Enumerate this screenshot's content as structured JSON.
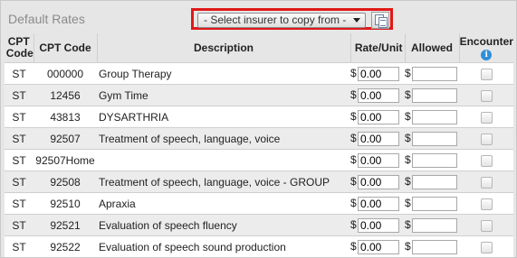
{
  "panel_title": "Default Rates",
  "copy_from": {
    "selected": "- Select insurer to copy from -",
    "icon": "copy-document-icon"
  },
  "columns": {
    "cpt_code_type": "CPT Code",
    "cpt_code": "CPT Code",
    "description": "Description",
    "rate_unit": "Rate/Unit",
    "allowed": "Allowed",
    "encounter": "Encounter"
  },
  "currency_symbol": "$",
  "rows": [
    {
      "type": "ST",
      "code": "000000",
      "description": "Group Therapy",
      "rate": "0.00",
      "allowed": "",
      "encounter": false
    },
    {
      "type": "ST",
      "code": "12456",
      "description": "Gym Time",
      "rate": "0.00",
      "allowed": "",
      "encounter": false
    },
    {
      "type": "ST",
      "code": "43813",
      "description": "DYSARTHRIA",
      "rate": "0.00",
      "allowed": "",
      "encounter": false
    },
    {
      "type": "ST",
      "code": "92507",
      "description": "Treatment of speech, language, voice",
      "rate": "0.00",
      "allowed": "",
      "encounter": false
    },
    {
      "type": "ST",
      "code": "92507Home",
      "description": "",
      "rate": "0.00",
      "allowed": "",
      "encounter": false
    },
    {
      "type": "ST",
      "code": "92508",
      "description": "Treatment of speech, language, voice - GROUP",
      "rate": "0.00",
      "allowed": "",
      "encounter": false
    },
    {
      "type": "ST",
      "code": "92510",
      "description": "Apraxia",
      "rate": "0.00",
      "allowed": "",
      "encounter": false
    },
    {
      "type": "ST",
      "code": "92521",
      "description": "Evaluation of speech fluency",
      "rate": "0.00",
      "allowed": "",
      "encounter": false
    },
    {
      "type": "ST",
      "code": "92522",
      "description": "Evaluation of speech sound production",
      "rate": "0.00",
      "allowed": "",
      "encounter": false
    }
  ]
}
